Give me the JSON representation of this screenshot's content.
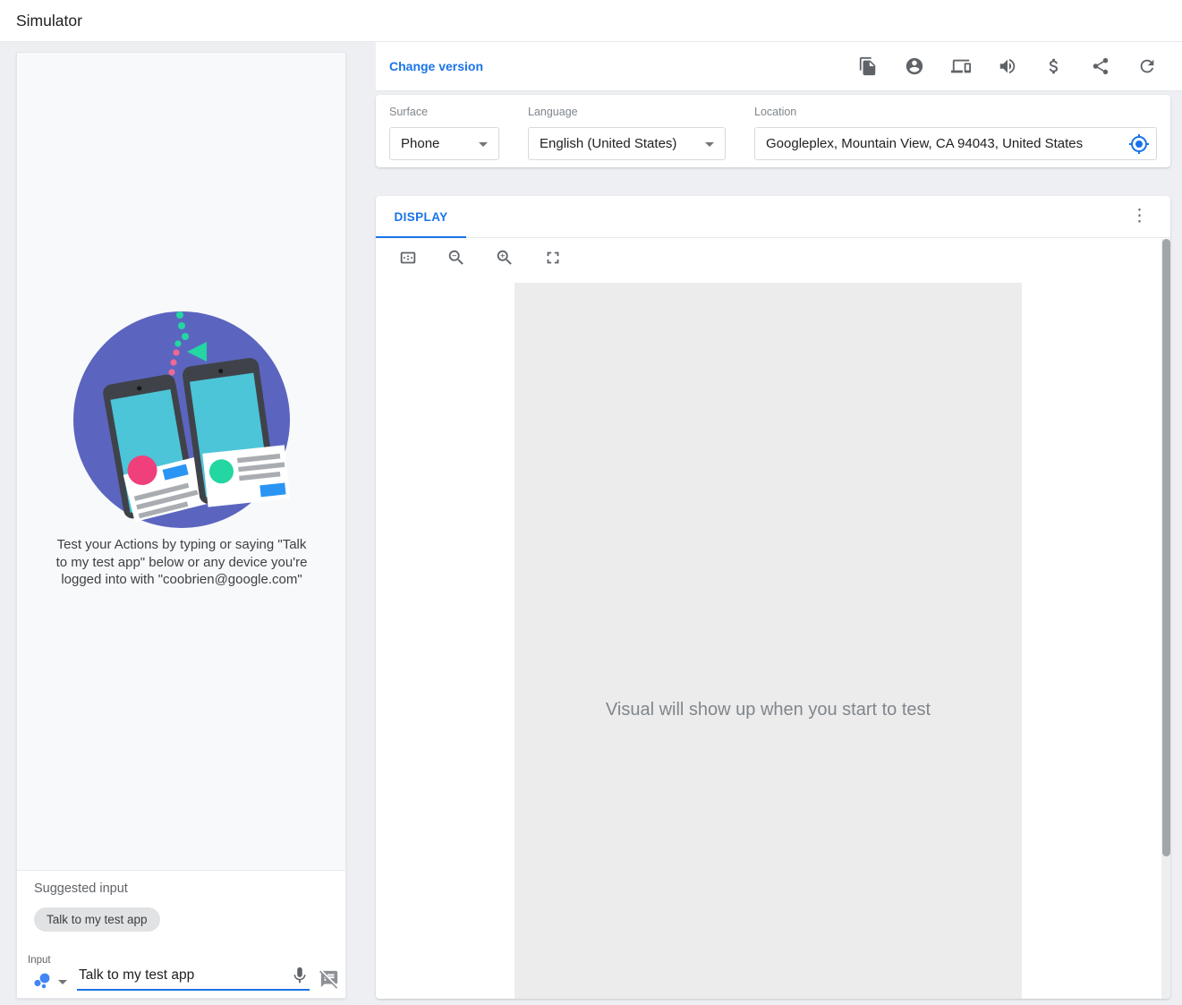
{
  "header": {
    "title": "Simulator"
  },
  "version_bar": {
    "change_version_label": "Change version",
    "icons": [
      "file-copy",
      "account",
      "devices",
      "volume",
      "billing",
      "share",
      "refresh"
    ]
  },
  "settings": {
    "surface": {
      "label": "Surface",
      "value": "Phone"
    },
    "language": {
      "label": "Language",
      "value": "English (United States)"
    },
    "location": {
      "label": "Location",
      "value": "Googleplex, Mountain View, CA 94043, United States",
      "icon": "my-location"
    }
  },
  "display_panel": {
    "tab_label": "DISPLAY",
    "menu_icon": "more-vertical",
    "tool_icons": [
      "fit-screen",
      "zoom-out",
      "zoom-in",
      "fullscreen"
    ],
    "placeholder": "Visual will show up when you start to test"
  },
  "left_panel": {
    "caption_lines": [
      "Test your Actions by typing or saying \"Talk",
      "to my test app\" below or any device you're",
      "logged into with \"coobrien@google.com\""
    ],
    "suggested_input_label": "Suggested input",
    "suggestion_chip": "Talk to my test app",
    "input_label": "Input",
    "input_value": "Talk to my test app",
    "input_icons": [
      "assistant",
      "dropdown-caret",
      "mic",
      "speaker-notes-off"
    ]
  },
  "colors": {
    "accent_blue": "#1a73e8",
    "icon_gray": "#5f6368",
    "illustration_purple": "#5b65bf",
    "screen_cyan": "#4cc5d8",
    "pink": "#f0407c",
    "green": "#23d6a2",
    "visual_panel_gray": "#ececec"
  }
}
